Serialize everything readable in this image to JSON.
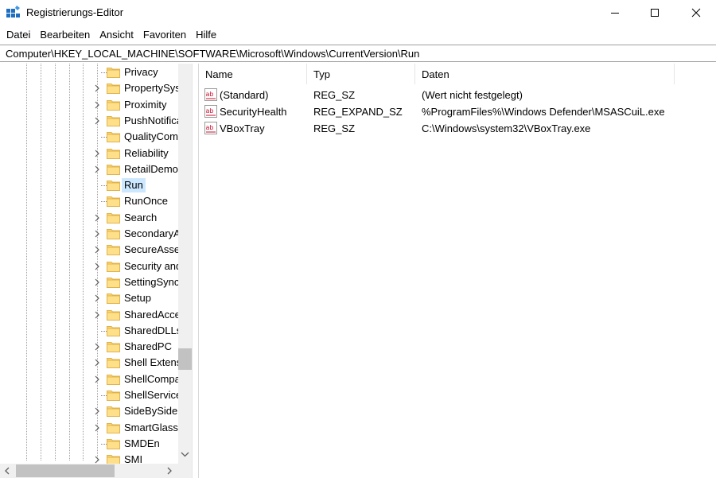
{
  "window": {
    "title": "Registrierungs-Editor",
    "colors": {
      "accent": "#0078d7",
      "selection": "#cce8ff",
      "folder": "#fcd472"
    }
  },
  "menu": [
    "Datei",
    "Bearbeiten",
    "Ansicht",
    "Favoriten",
    "Hilfe"
  ],
  "address": "Computer\\HKEY_LOCAL_MACHINE\\SOFTWARE\\Microsoft\\Windows\\CurrentVersion\\Run",
  "tree": {
    "items": [
      {
        "label": "Privacy",
        "expandable": false,
        "selected": false
      },
      {
        "label": "PropertySystem",
        "expandable": true,
        "selected": false
      },
      {
        "label": "Proximity",
        "expandable": true,
        "selected": false
      },
      {
        "label": "PushNotifications",
        "expandable": true,
        "selected": false
      },
      {
        "label": "QualityCompat",
        "expandable": false,
        "selected": false
      },
      {
        "label": "Reliability",
        "expandable": true,
        "selected": false
      },
      {
        "label": "RetailDemo",
        "expandable": true,
        "selected": false
      },
      {
        "label": "Run",
        "expandable": false,
        "selected": true
      },
      {
        "label": "RunOnce",
        "expandable": false,
        "selected": false
      },
      {
        "label": "Search",
        "expandable": true,
        "selected": false
      },
      {
        "label": "SecondaryAuthFactor",
        "expandable": true,
        "selected": false
      },
      {
        "label": "SecureAssessment",
        "expandable": true,
        "selected": false
      },
      {
        "label": "Security and Maintenance",
        "expandable": true,
        "selected": false
      },
      {
        "label": "SettingSync",
        "expandable": true,
        "selected": false
      },
      {
        "label": "Setup",
        "expandable": true,
        "selected": false
      },
      {
        "label": "SharedAccess",
        "expandable": true,
        "selected": false
      },
      {
        "label": "SharedDLLs",
        "expandable": false,
        "selected": false
      },
      {
        "label": "SharedPC",
        "expandable": true,
        "selected": false
      },
      {
        "label": "Shell Extensions",
        "expandable": true,
        "selected": false
      },
      {
        "label": "ShellCompatibility",
        "expandable": true,
        "selected": false
      },
      {
        "label": "ShellServiceObjectDelayLoad",
        "expandable": false,
        "selected": false
      },
      {
        "label": "SideBySide",
        "expandable": true,
        "selected": false
      },
      {
        "label": "SmartGlass",
        "expandable": true,
        "selected": false
      },
      {
        "label": "SMDEn",
        "expandable": false,
        "selected": false
      },
      {
        "label": "SMI",
        "expandable": true,
        "selected": false
      }
    ]
  },
  "list": {
    "columns": {
      "name": "Name",
      "type": "Typ",
      "data": "Daten"
    },
    "rows": [
      {
        "name": "(Standard)",
        "type": "REG_SZ",
        "data": "(Wert nicht festgelegt)",
        "icon": "string-value-icon"
      },
      {
        "name": "SecurityHealth",
        "type": "REG_EXPAND_SZ",
        "data": "%ProgramFiles%\\Windows Defender\\MSASCuiL.exe",
        "icon": "string-value-icon"
      },
      {
        "name": "VBoxTray",
        "type": "REG_SZ",
        "data": "C:\\Windows\\system32\\VBoxTray.exe",
        "icon": "string-value-icon"
      }
    ]
  }
}
